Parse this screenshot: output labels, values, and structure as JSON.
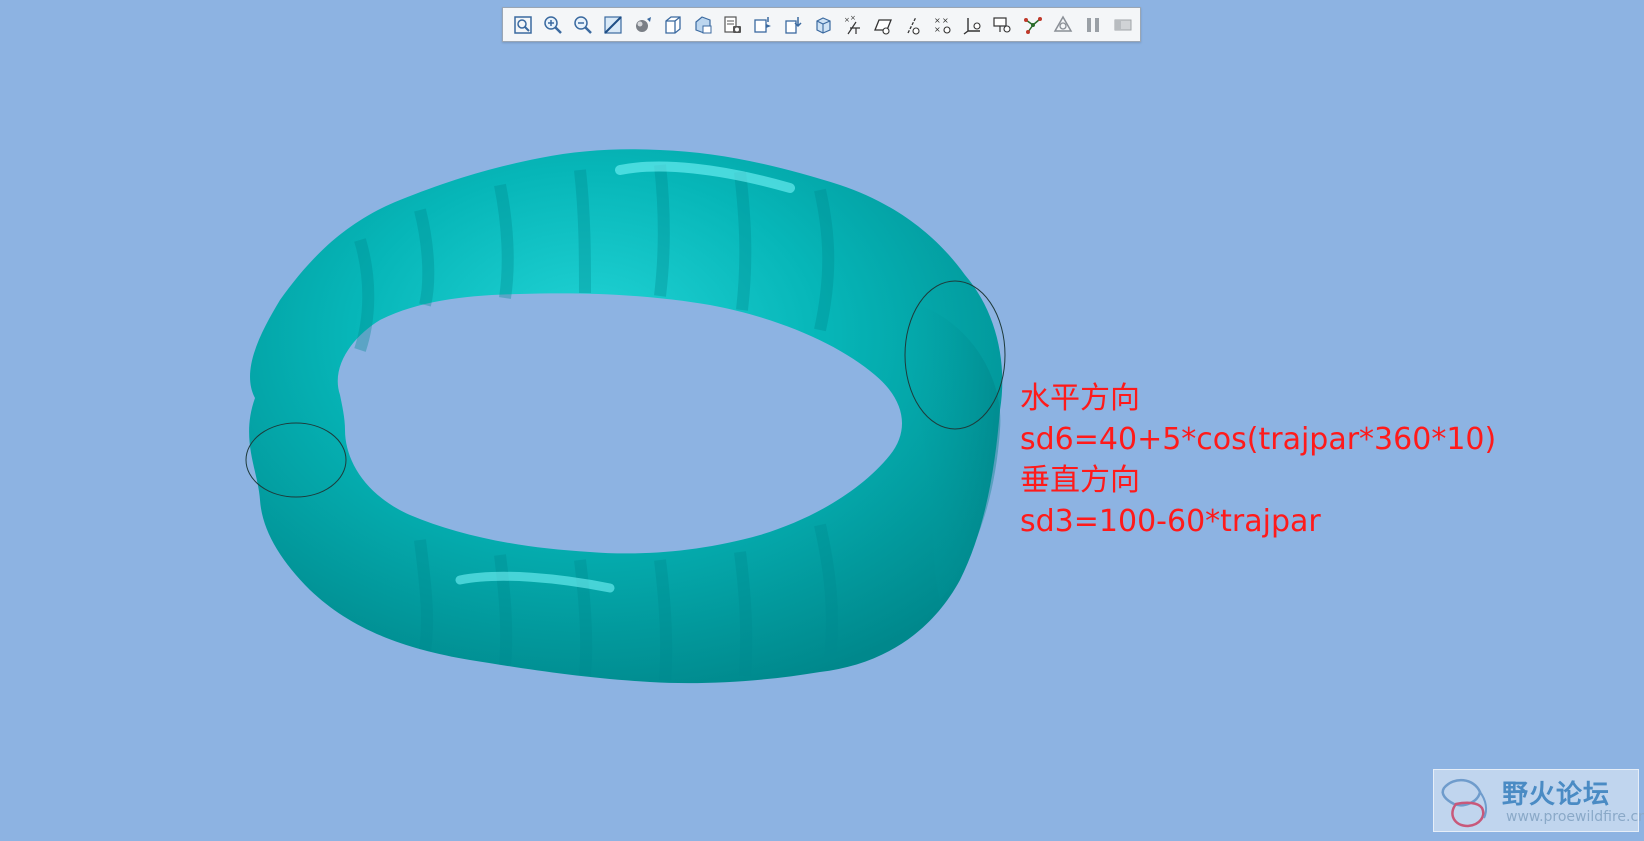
{
  "toolbar": {
    "buttons": [
      {
        "name": "refit-icon"
      },
      {
        "name": "zoom-in-icon"
      },
      {
        "name": "zoom-out-icon"
      },
      {
        "name": "repaint-icon"
      },
      {
        "name": "display-style-icon"
      },
      {
        "name": "saved-orientations-icon"
      },
      {
        "name": "view-manager-icon"
      },
      {
        "name": "section-view-icon"
      },
      {
        "name": "named-views-icon"
      },
      {
        "name": "perspective-view-icon"
      },
      {
        "name": "spin-center-icon"
      },
      {
        "name": "datum-display-icon"
      },
      {
        "name": "plane-display-icon"
      },
      {
        "name": "axis-display-icon"
      },
      {
        "name": "point-display-icon"
      },
      {
        "name": "csys-display-icon"
      },
      {
        "name": "annotation-display-icon"
      },
      {
        "name": "connection-display-icon"
      },
      {
        "name": "regenerate-icon"
      },
      {
        "name": "pause-icon"
      },
      {
        "name": "stop-icon"
      }
    ]
  },
  "annotations": {
    "line1": "水平方向",
    "line2": "sd6=40+5*cos(trajpar*360*10)",
    "line3": "垂直方向",
    "line4": "sd3=100-60*trajpar"
  },
  "watermark": {
    "title": "野火论坛",
    "url": "www.proewildfire.cn"
  },
  "colors": {
    "background": "#8db3e2",
    "model": "#00b4b8",
    "annotation_text": "#ff1a1a"
  }
}
